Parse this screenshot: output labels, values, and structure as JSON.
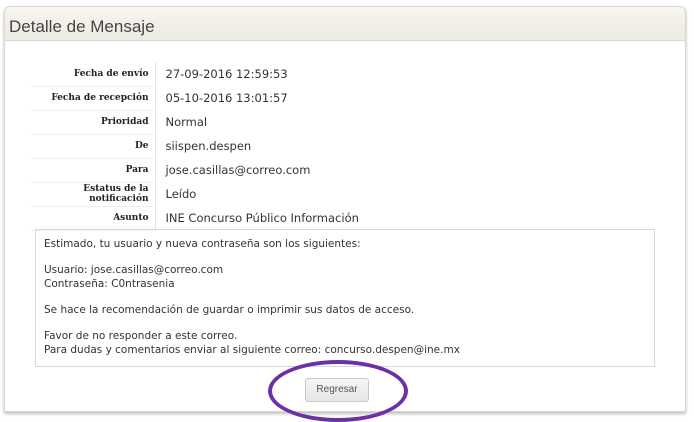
{
  "header": {
    "title": "Detalle de Mensaje"
  },
  "details": [
    {
      "label": "Fecha de envío",
      "value": "27-09-2016 12:59:53"
    },
    {
      "label": "Fecha de recepción",
      "value": "05-10-2016 13:01:57"
    },
    {
      "label": "Prioridad",
      "value": "Normal"
    },
    {
      "label": "De",
      "value": "siispen.despen"
    },
    {
      "label": "Para",
      "value": "jose.casillas@correo.com"
    },
    {
      "label": "Estatus de la notificación",
      "value": "Leído"
    },
    {
      "label": "Asunto",
      "value": "INE Concurso Público Información"
    }
  ],
  "message": {
    "greeting": "Estimado, tu usuario y nueva contraseña son los siguientes:",
    "user_line": "Usuario: jose.casillas@correo.com",
    "password_line": "Contraseña: C0ntrasenia",
    "recommendation": "Se hace la recomendación de guardar o imprimir sus datos de acceso.",
    "no_reply": "Favor de no responder a este correo.",
    "contact": "Para dudas y comentarios enviar al siguiente correo: concurso.despen@ine.mx"
  },
  "actions": {
    "back_label": "Regresar"
  },
  "colors": {
    "highlight": "#6d2fa5"
  }
}
